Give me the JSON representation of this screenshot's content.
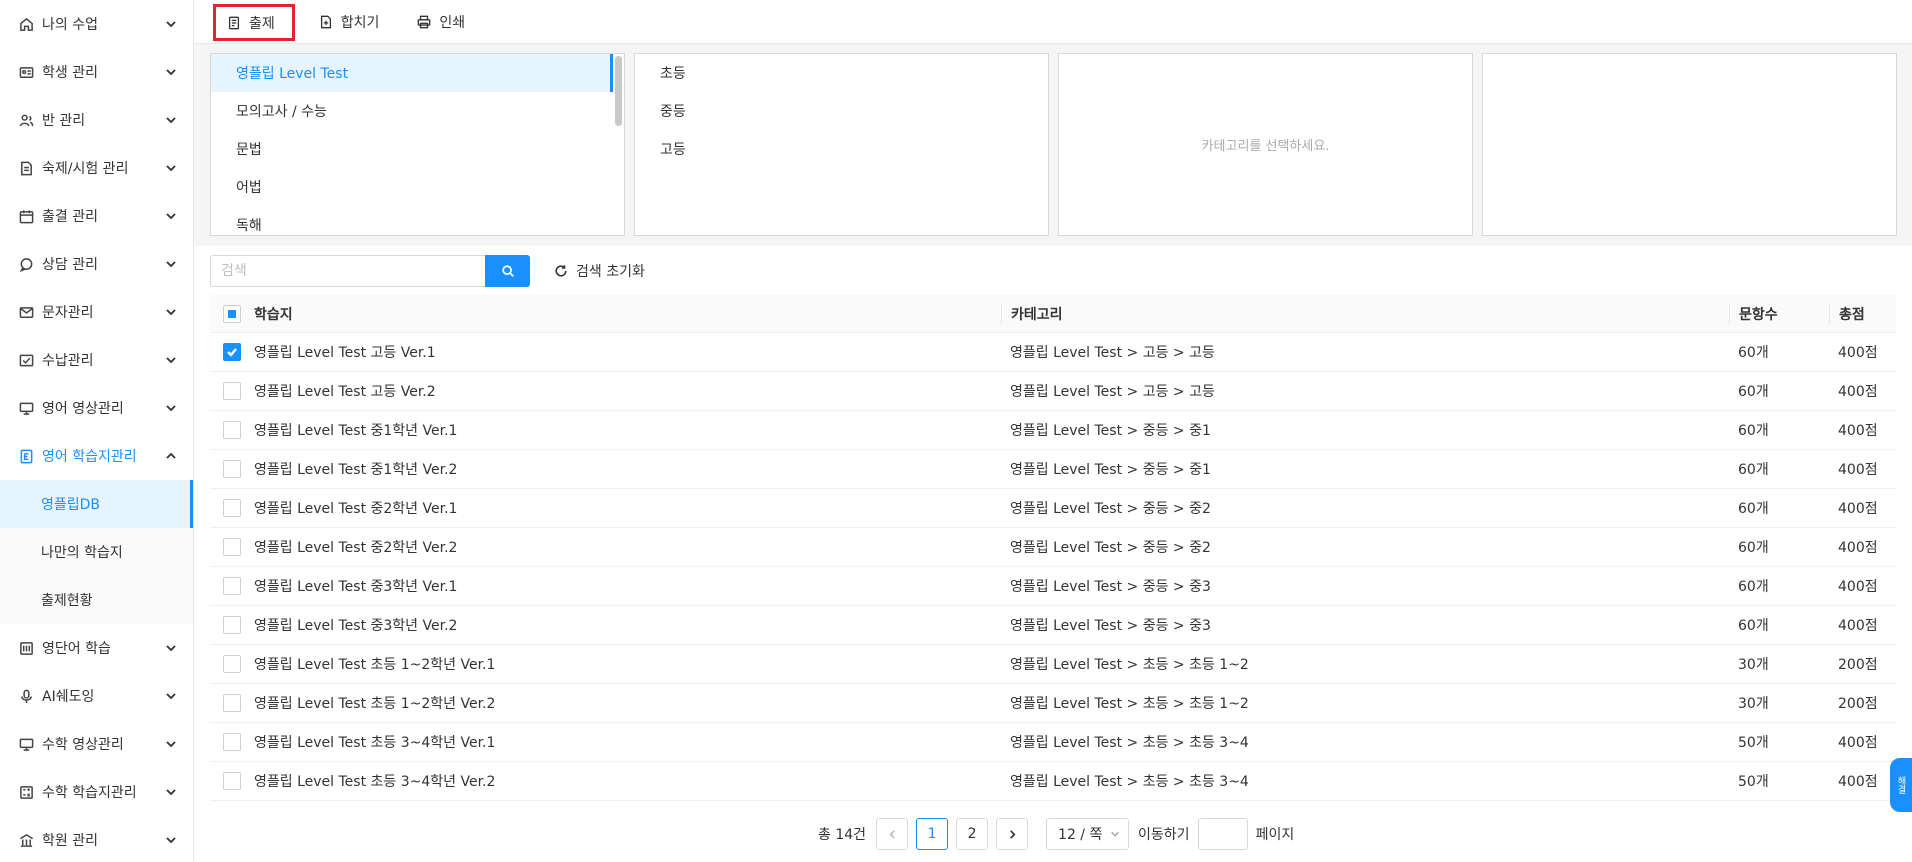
{
  "sidebar": {
    "items": [
      {
        "label": "나의 수업",
        "icon": "home-icon"
      },
      {
        "label": "학생 관리",
        "icon": "id-card-icon"
      },
      {
        "label": "반 관리",
        "icon": "users-icon"
      },
      {
        "label": "숙제/시험 관리",
        "icon": "document-icon"
      },
      {
        "label": "출결 관리",
        "icon": "calendar-icon"
      },
      {
        "label": "상담 관리",
        "icon": "chat-icon"
      },
      {
        "label": "문자관리",
        "icon": "mail-icon"
      },
      {
        "label": "수납관리",
        "icon": "payment-icon"
      },
      {
        "label": "영어 영상관리",
        "icon": "monitor-icon"
      },
      {
        "label": "영어 학습지관리",
        "icon": "book-icon",
        "open": true
      },
      {
        "label": "영단어 학습",
        "icon": "vocab-icon"
      },
      {
        "label": "AI쉐도잉",
        "icon": "microphone-icon"
      },
      {
        "label": "수학 영상관리",
        "icon": "monitor-icon"
      },
      {
        "label": "수학 학습지관리",
        "icon": "calculator-icon"
      },
      {
        "label": "학원 관리",
        "icon": "building-icon"
      }
    ],
    "submenu": [
      {
        "label": "영플립DB",
        "active": true
      },
      {
        "label": "나만의 학습지"
      },
      {
        "label": "출제현황"
      }
    ]
  },
  "toolbar": {
    "publish_label": "출제",
    "merge_label": "합치기",
    "print_label": "인쇄"
  },
  "panels": {
    "level1": [
      "영플립 Level Test",
      "모의고사 / 수능",
      "문법",
      "어법",
      "독해"
    ],
    "level2": [
      "초등",
      "중등",
      "고등"
    ],
    "empty_message": "카테고리를 선택하세요."
  },
  "search": {
    "placeholder": "검색",
    "reset_label": "검색 초기화"
  },
  "table": {
    "headers": {
      "name": "학습지",
      "category": "카테고리",
      "count": "문항수",
      "score": "총점"
    },
    "rows": [
      {
        "name": "영플립 Level Test 고등 Ver.1",
        "category": "영플립 Level Test > 고등 > 고등",
        "count": "60개",
        "score": "400점",
        "checked": true
      },
      {
        "name": "영플립 Level Test 고등 Ver.2",
        "category": "영플립 Level Test > 고등 > 고등",
        "count": "60개",
        "score": "400점"
      },
      {
        "name": "영플립 Level Test 중1학년 Ver.1",
        "category": "영플립 Level Test > 중등 > 중1",
        "count": "60개",
        "score": "400점"
      },
      {
        "name": "영플립 Level Test 중1학년 Ver.2",
        "category": "영플립 Level Test > 중등 > 중1",
        "count": "60개",
        "score": "400점"
      },
      {
        "name": "영플립 Level Test 중2학년 Ver.1",
        "category": "영플립 Level Test > 중등 > 중2",
        "count": "60개",
        "score": "400점"
      },
      {
        "name": "영플립 Level Test 중2학년 Ver.2",
        "category": "영플립 Level Test > 중등 > 중2",
        "count": "60개",
        "score": "400점"
      },
      {
        "name": "영플립 Level Test 중3학년 Ver.1",
        "category": "영플립 Level Test > 중등 > 중3",
        "count": "60개",
        "score": "400점"
      },
      {
        "name": "영플립 Level Test 중3학년 Ver.2",
        "category": "영플립 Level Test > 중등 > 중3",
        "count": "60개",
        "score": "400점"
      },
      {
        "name": "영플립 Level Test 초등 1~2학년 Ver.1",
        "category": "영플립 Level Test > 초등 > 초등 1~2",
        "count": "30개",
        "score": "200점"
      },
      {
        "name": "영플립 Level Test 초등 1~2학년 Ver.2",
        "category": "영플립 Level Test > 초등 > 초등 1~2",
        "count": "30개",
        "score": "200점"
      },
      {
        "name": "영플립 Level Test 초등 3~4학년 Ver.1",
        "category": "영플립 Level Test > 초등 > 초등 3~4",
        "count": "50개",
        "score": "400점"
      },
      {
        "name": "영플립 Level Test 초등 3~4학년 Ver.2",
        "category": "영플립 Level Test > 초등 > 초등 3~4",
        "count": "50개",
        "score": "400점"
      }
    ]
  },
  "pagination": {
    "total_label": "총 14건",
    "pages": [
      "1",
      "2"
    ],
    "current_page": "1",
    "page_size_label": "12 / 쪽",
    "goto_label": "이동하기",
    "page_label": "페이지"
  },
  "float_button": {
    "label": "해결"
  },
  "colors": {
    "accent": "#1890ff",
    "highlight_border": "#e0262a",
    "active_bg": "#e6f4ff"
  }
}
